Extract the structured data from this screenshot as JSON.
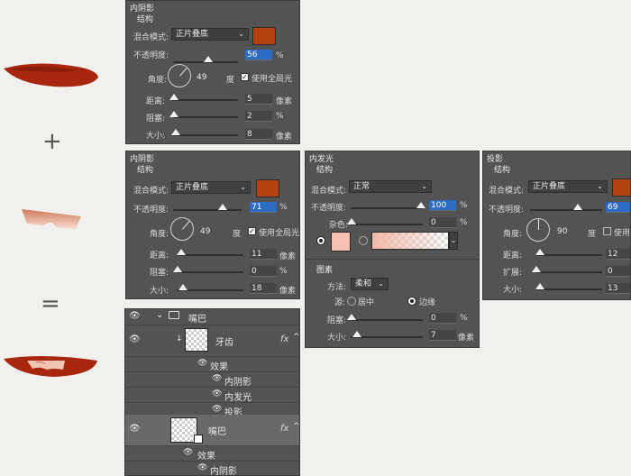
{
  "symbols": {
    "plus": "+",
    "equals": "="
  },
  "colors": {
    "lip": "#a8260e",
    "teeth_top": "#d48a6c",
    "panel": "#535353",
    "accent_swatch": "#b3440f",
    "glow_swatch": "#f6c0b2"
  },
  "panel1": {
    "title": "内阴影",
    "section": "结构",
    "blend_label": "混合模式:",
    "blend_value": "正片叠底",
    "opacity_label": "不透明度:",
    "opacity_value": "56",
    "opacity_unit": "%",
    "opacity_pct": 56,
    "angle_label": "角度:",
    "angle_value": "49",
    "angle_unit": "度",
    "global_light": "使用全局光",
    "angle_deg": 49,
    "distance_label": "距离:",
    "distance_value": "5",
    "distance_unit": "像素",
    "choke_label": "阻塞:",
    "choke_value": "2",
    "choke_unit": "%",
    "size_label": "大小:",
    "size_value": "8",
    "size_unit": "像素"
  },
  "panel2": {
    "title": "内阴影",
    "section": "结构",
    "blend_label": "混合模式:",
    "blend_value": "正片叠底",
    "opacity_label": "不透明度:",
    "opacity_value": "71",
    "opacity_unit": "%",
    "angle_label": "角度:",
    "angle_value": "49",
    "angle_unit": "度",
    "global_light": "使用全局光",
    "distance_label": "距离:",
    "distance_value": "11",
    "distance_unit": "像素",
    "choke_label": "阻塞:",
    "choke_value": "0",
    "choke_unit": "%",
    "size_label": "大小:",
    "size_value": "18",
    "size_unit": "像素"
  },
  "panel3": {
    "title": "内发光",
    "section": "结构",
    "blend_label": "混合模式:",
    "blend_value": "正常",
    "opacity_label": "不透明度:",
    "opacity_value": "100",
    "opacity_unit": "%",
    "noise_label": "杂色:",
    "noise_value": "0",
    "noise_unit": "%",
    "elements_title": "图素",
    "method_label": "方法:",
    "method_value": "柔和",
    "source_label": "源:",
    "source_center": "居中",
    "source_edge": "边缘",
    "choke_label": "阻塞:",
    "choke_value": "0",
    "choke_unit": "%",
    "size_label": "大小:",
    "size_value": "7",
    "size_unit": "像素"
  },
  "panel4": {
    "title": "投影",
    "section": "结构",
    "blend_label": "混合模式:",
    "blend_value": "正片叠底",
    "opacity_label": "不透明度:",
    "opacity_value": "69",
    "angle_label": "角度:",
    "angle_value": "90",
    "angle_unit": "度",
    "global_light": "使用",
    "distance_label": "距离:",
    "distance_value": "12",
    "spread_label": "扩展:",
    "spread_value": "0",
    "size_label": "大小:",
    "size_value": "13"
  },
  "layers": {
    "group_name": "嘴巴",
    "teeth_name": "牙齿",
    "effects_label": "效果",
    "teeth_effects": [
      "内阴影",
      "内发光",
      "投影"
    ],
    "mouth_name": "嘴巴",
    "mouth_effects": [
      "内阴影"
    ],
    "fx": "fx"
  }
}
